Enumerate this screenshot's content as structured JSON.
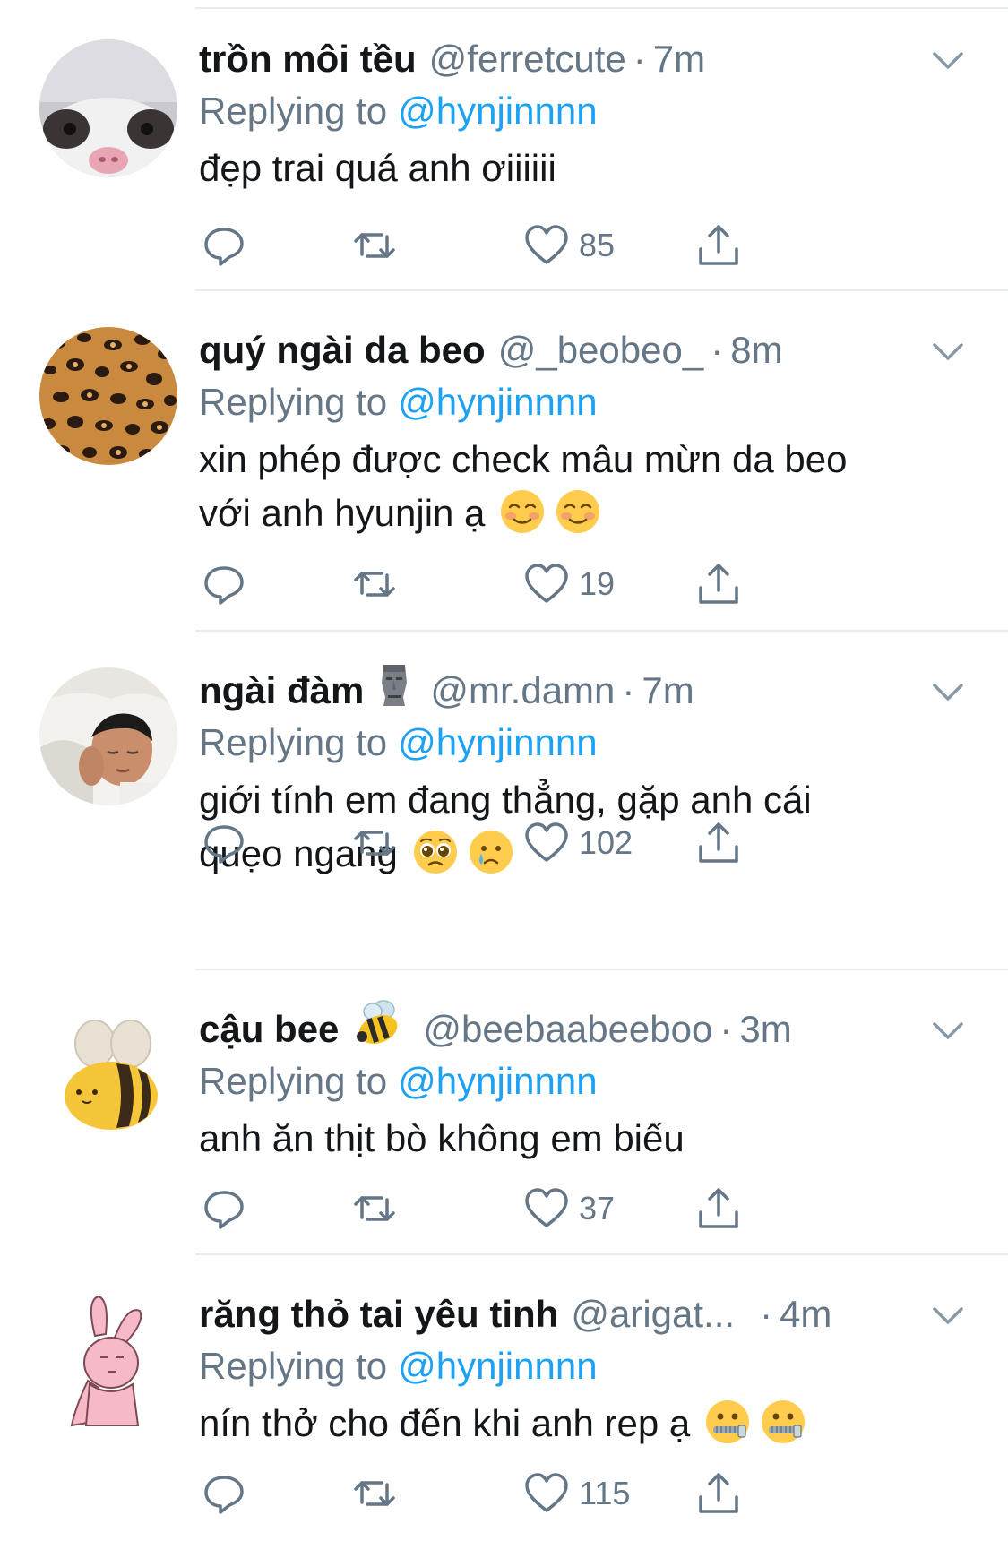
{
  "tweets": [
    {
      "name": "trồn môi tều",
      "name_icon": "",
      "handle": "@ferretcute",
      "separator": "·",
      "time": "7m",
      "replying_label": "Replying to",
      "replying_to": "@hynjinnnn",
      "text_lines": [
        "đẹp trai quá anh ơiiiiii"
      ],
      "emoji": [],
      "like_count": "85",
      "avatar": "ferret-avatar"
    },
    {
      "name": "quý ngài da beo",
      "name_icon": "",
      "handle": "@_beobeo_",
      "separator": "·",
      "time": "8m",
      "replying_label": "Replying to",
      "replying_to": "@hynjinnnn",
      "text_lines": [
        "xin phép được check mâu mừn da beo",
        "với anh hyunjin ạ"
      ],
      "emoji": [
        "smiling-blush-emoji",
        "smiling-blush-emoji"
      ],
      "like_count": "19",
      "avatar": "leopard-print-avatar"
    },
    {
      "name": "ngài đàm",
      "name_icon": "moai-emoji",
      "handle": "@mr.damn",
      "separator": "·",
      "time": "7m",
      "replying_label": "Replying to",
      "replying_to": "@hynjinnnn",
      "text_lines": [
        "giới tính em đang thẳng, gặp anh cái",
        "quẹo ngang"
      ],
      "emoji": [
        "pleading-face-emoji",
        "sad-tear-face-emoji"
      ],
      "like_count": "102",
      "avatar": "sleeping-man-avatar"
    },
    {
      "name": "cậu bee",
      "name_icon": "bee-emoji",
      "handle": "@beebaabeeboo",
      "separator": "·",
      "time": "3m",
      "replying_label": "Replying to",
      "replying_to": "@hynjinnnn",
      "text_lines": [
        "anh ăn thịt bò không em biếu"
      ],
      "emoji": [],
      "like_count": "37",
      "avatar": "bee-avatar"
    },
    {
      "name": "răng thỏ tai yêu tinh",
      "name_icon": "",
      "handle": "@arigat...",
      "separator": "·",
      "time": "4m",
      "replying_label": "Replying to",
      "replying_to": "@hynjinnnn",
      "text_lines": [
        "nín thở cho đến khi anh rep ạ"
      ],
      "emoji": [
        "zipper-mouth-face-emoji",
        "zipper-mouth-face-emoji"
      ],
      "like_count": "115",
      "avatar": "pink-rabbit-avatar"
    }
  ],
  "icons": {
    "reply": "reply-icon",
    "retweet": "retweet-icon",
    "like": "heart-icon",
    "share": "share-icon",
    "more": "chevron-down-icon"
  },
  "colors": {
    "text": "#14171a",
    "secondary": "#657786",
    "mention": "#1da1f2",
    "divider": "#e6ecf0"
  }
}
